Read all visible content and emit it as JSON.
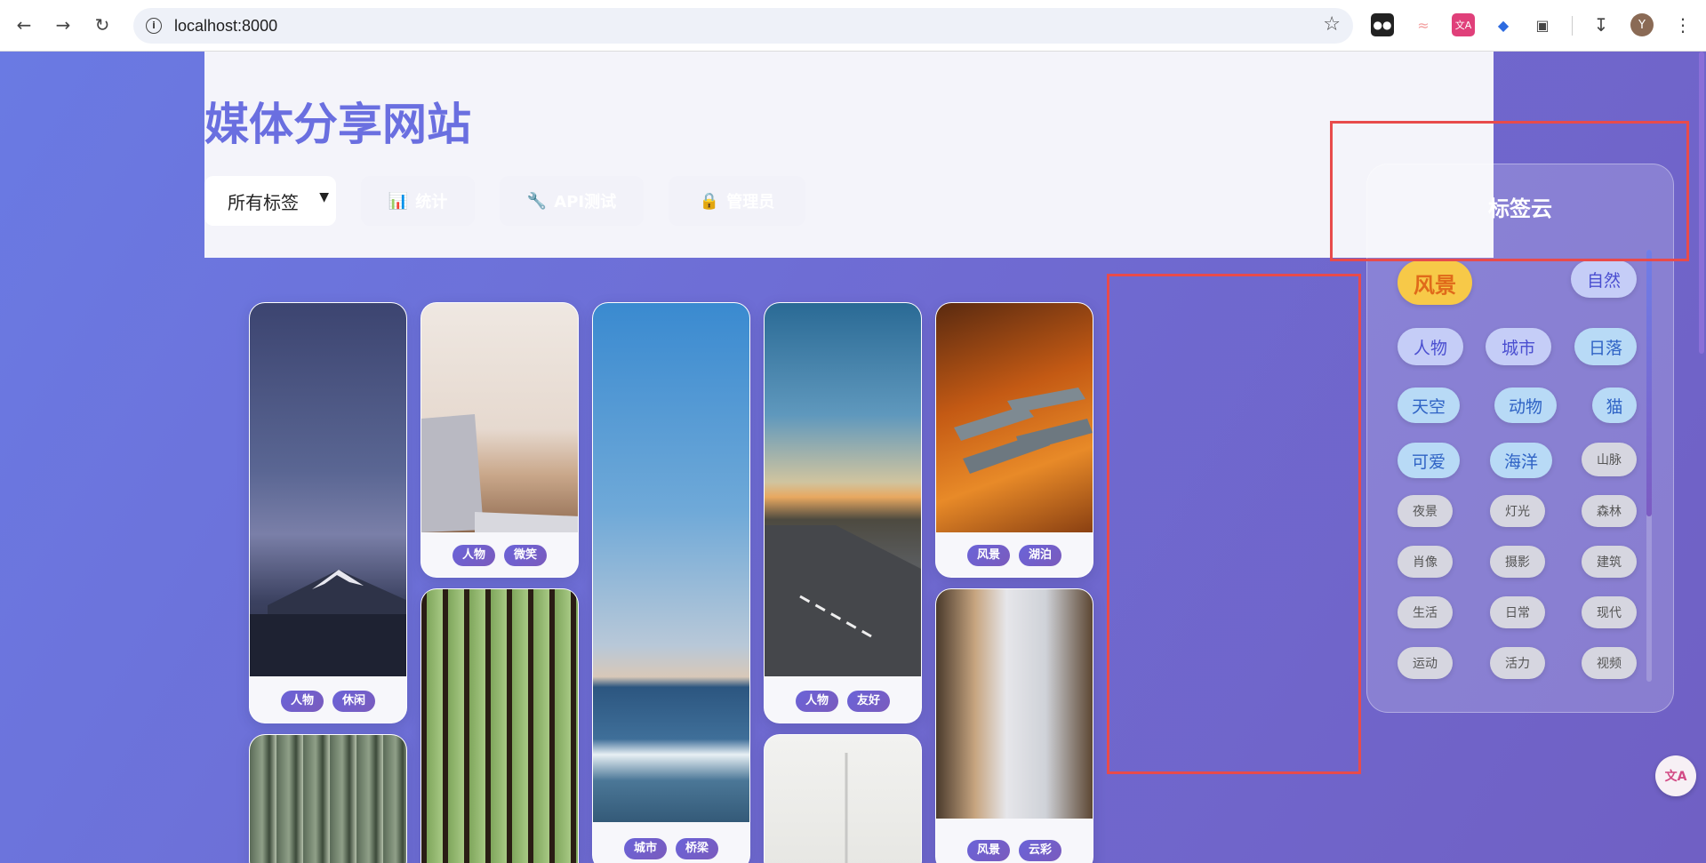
{
  "browser": {
    "url": "localhost:8000",
    "avatar_letter": "Y"
  },
  "site": {
    "title": "媒体分享网站",
    "tag_select": "所有标签",
    "nav": [
      {
        "icon": "📊",
        "label": "统计"
      },
      {
        "icon": "🔧",
        "label": "API测试"
      },
      {
        "icon": "🔒",
        "label": "管理员"
      }
    ]
  },
  "gallery": {
    "cards": [
      {
        "tags": [
          "人物",
          "休闲"
        ]
      },
      {
        "tags": [
          "人物",
          "微笑"
        ]
      },
      {
        "tags": [
          "城市",
          "桥梁"
        ]
      },
      {
        "tags": [
          "人物",
          "友好"
        ]
      },
      {
        "tags": [
          "风景",
          "湖泊"
        ]
      },
      {
        "tags": [
          "风景",
          "云彩"
        ]
      }
    ]
  },
  "tag_cloud": {
    "title": "标签云",
    "tags": [
      "风景",
      "自然",
      "人物",
      "城市",
      "日落",
      "天空",
      "动物",
      "猫",
      "可爱",
      "海洋",
      "山脉",
      "夜景",
      "灯光",
      "森林",
      "肖像",
      "摄影",
      "建筑",
      "生活",
      "日常",
      "现代",
      "运动",
      "活力",
      "视频"
    ]
  },
  "colors": {
    "accent": "#6a6fe0",
    "highlight_box": "#e84b4b",
    "pill": "#6a63d8"
  }
}
